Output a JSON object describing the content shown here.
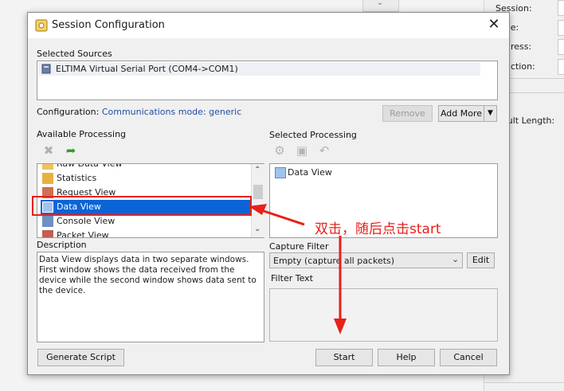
{
  "background": {
    "panel_labels": [
      "Session:",
      "ode:",
      "ddress:",
      "unction:",
      "sult Length:"
    ],
    "top_tab_icon": "chevron-down-icon"
  },
  "dialog": {
    "title": "Session Configuration",
    "close_icon": "close-icon",
    "selected_sources_label": "Selected Sources",
    "source_item": "ELTIMA Virtual Serial Port (COM4->COM1)",
    "configuration_label": "Configuration:",
    "configuration_value": "Communications mode: generic",
    "remove_button": "Remove",
    "add_more_button": "Add More",
    "available_processing_label": "Available Processing",
    "available_items": [
      "Raw Data View",
      "Statistics",
      "Request View",
      "Data View",
      "Console View",
      "Packet View"
    ],
    "available_selected": "Data View",
    "selected_processing_label": "Selected Processing",
    "selected_items": [
      "Data View"
    ],
    "description_label": "Description",
    "description_text": "Data View displays data in two separate windows. First window shows the data received from the device while the second window shows data sent to the device.",
    "capture_filter_label": "Capture Filter",
    "capture_filter_value": "Empty (capture all packets)",
    "edit_button": "Edit",
    "filter_text_label": "Filter Text",
    "generate_script_button": "Generate Script",
    "start_button": "Start",
    "help_button": "Help",
    "cancel_button": "Cancel"
  },
  "annotation": {
    "text": "双击，随后点击start",
    "color": "#e8201a"
  }
}
